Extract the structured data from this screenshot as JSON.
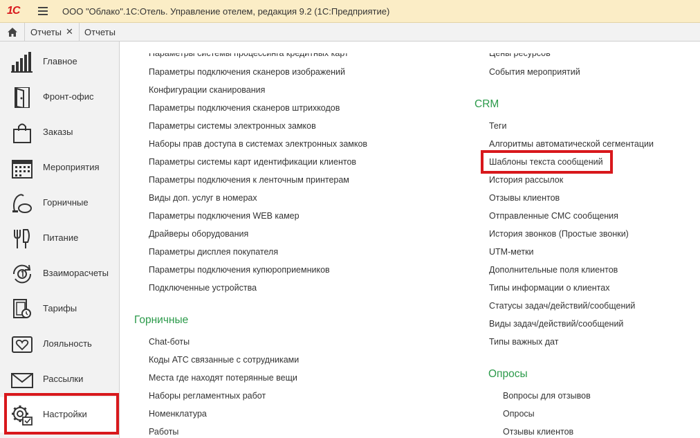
{
  "app": {
    "logo": "1С",
    "title": "ООО \"Облако\".1С:Отель. Управление отелем, редакция 9.2  (1С:Предприятие)"
  },
  "tabs": [
    {
      "label": "Отчеты",
      "close": "✕"
    },
    {
      "label": "Отчеты"
    }
  ],
  "sidebar": {
    "items": [
      {
        "label": "Главное",
        "icon": "bar-chart-icon"
      },
      {
        "label": "Фронт-офис",
        "icon": "door-icon"
      },
      {
        "label": "Заказы",
        "icon": "shopping-bag-icon"
      },
      {
        "label": "Мероприятия",
        "icon": "calendar-icon"
      },
      {
        "label": "Горничные",
        "icon": "vacuum-icon"
      },
      {
        "label": "Питание",
        "icon": "fork-cup-icon"
      },
      {
        "label": "Взаиморасчеты",
        "icon": "refresh-coin-icon"
      },
      {
        "label": "Тарифы",
        "icon": "tariff-icon"
      },
      {
        "label": "Лояльность",
        "icon": "heart-icon"
      },
      {
        "label": "Рассылки",
        "icon": "envelope-icon"
      },
      {
        "label": "Настройки",
        "icon": "gear-icon"
      }
    ],
    "active": "Настройки"
  },
  "main": {
    "left_column": {
      "cut_top": "Параметры системы процессинга кредитных карт",
      "links_top": [
        "Параметры подключения сканеров изображений",
        "Конфигурации сканирования",
        "Параметры подключения сканеров штрихкодов",
        "Параметры системы электронных замков",
        "Наборы прав доступа в системах электронных замков",
        "Параметры системы карт идентификации клиентов",
        "Параметры подключения к ленточным принтерам",
        "Виды доп. услуг в номерах",
        "Параметры подключения WEB камер",
        "Драйверы оборудования",
        "Параметры дисплея покупателя",
        "Параметры подключения купюроприемников",
        "Подключенные устройства"
      ],
      "section_maids": "Горничные",
      "links_maids": [
        "Chat-боты",
        "Коды АТС связанные с сотрудниками",
        "Места где находят потерянные вещи",
        "Наборы регламентных работ",
        "Номенклатура",
        "Работы"
      ]
    },
    "right_column": {
      "cut_top": "Цены ресурсов",
      "links_top": [
        "События мероприятий"
      ],
      "section_crm": "CRM",
      "links_crm": [
        "Теги",
        "Алгоритмы автоматической сегментации",
        "Шаблоны текста сообщений",
        "История рассылок",
        "Отзывы клиентов",
        "Отправленные СМС сообщения",
        "История звонков (Простые звонки)",
        "UTM-метки",
        "Дополнительные поля клиентов",
        "Типы информации о клиентах",
        "Статусы задач/действий/сообщений",
        "Виды задач/действий/сообщений",
        "Типы важных дат"
      ],
      "section_polls": "Опросы",
      "links_polls": [
        "Вопросы для отзывов",
        "Опросы",
        "Отзывы клиентов"
      ]
    }
  },
  "colors": {
    "section_green": "#2b9a4a",
    "highlight_red": "#d8181c",
    "titlebar": "#fbedc6",
    "sidebar": "#f2f2f2"
  }
}
